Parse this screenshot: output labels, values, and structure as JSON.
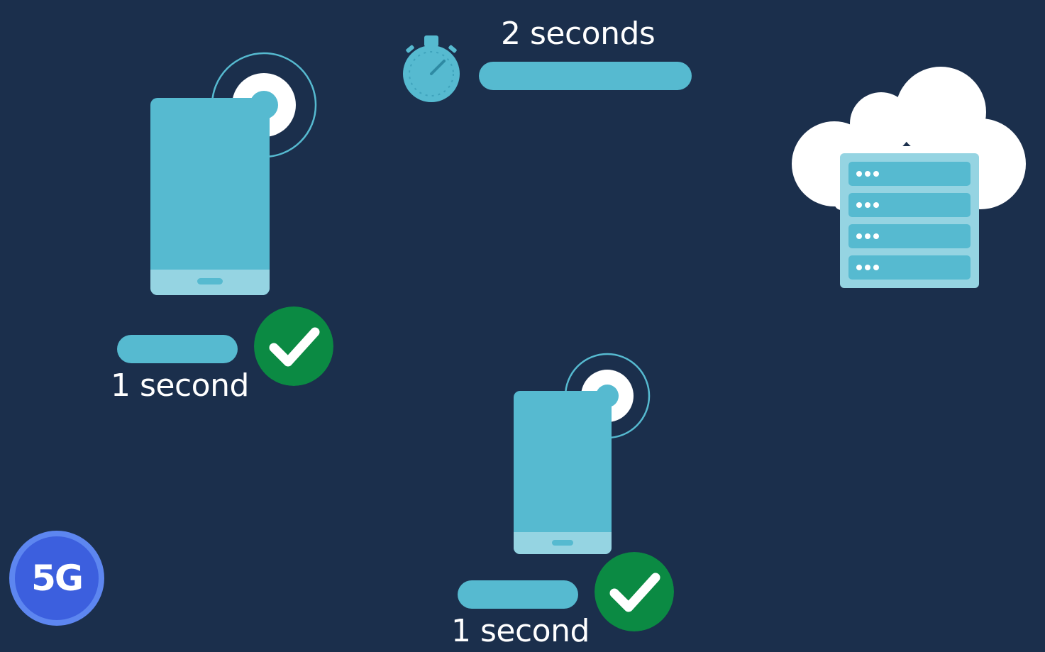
{
  "timer": {
    "label": "2 seconds"
  },
  "device_top": {
    "time_label": "1 second",
    "status": "success"
  },
  "device_bottom": {
    "time_label": "1 second",
    "status": "success"
  },
  "network_badge": {
    "label": "5G"
  },
  "colors": {
    "background": "#1b2f4c",
    "accent": "#56bad0",
    "success": "#0b8a43",
    "badge": "#3c5fde"
  },
  "icons": [
    "stopwatch-icon",
    "phone-icon",
    "cloud-server-icon",
    "check-icon",
    "signal-ring-icon"
  ]
}
